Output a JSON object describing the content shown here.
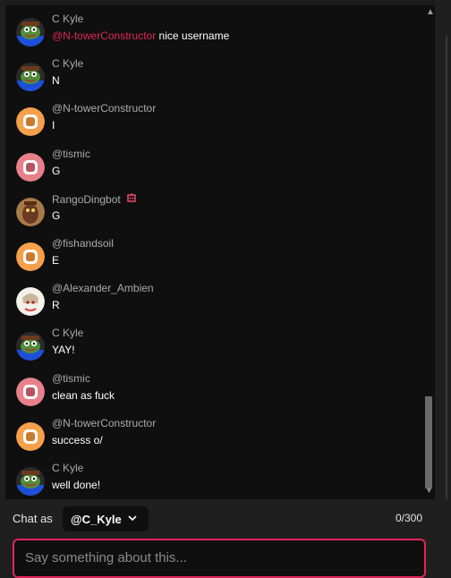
{
  "messages": [
    {
      "author": "C Kyle",
      "mention": "@N-towerConstructor",
      "text": " nice username",
      "avatar": "pepe-avatar-icon"
    },
    {
      "author": "C Kyle",
      "mention": "",
      "text": "N",
      "avatar": "pepe-avatar-icon"
    },
    {
      "author": "@N-towerConstructor",
      "mention": "",
      "text": "I",
      "avatar": "orange-default-avatar-icon"
    },
    {
      "author": "@tismic",
      "mention": "",
      "text": "G",
      "avatar": "red-default-avatar-icon"
    },
    {
      "author": "RangoDingbot",
      "mention": "",
      "text": "G",
      "avatar": "rango-avatar-icon",
      "badge": "bot-badge-icon"
    },
    {
      "author": "@fishandsoil",
      "mention": "",
      "text": "E",
      "avatar": "orange-default-avatar-icon"
    },
    {
      "author": "@Alexander_Ambien",
      "mention": "",
      "text": "R",
      "avatar": "anime-avatar-icon"
    },
    {
      "author": "C Kyle",
      "mention": "",
      "text": "YAY!",
      "avatar": "pepe-avatar-icon"
    },
    {
      "author": "@tismic",
      "mention": "",
      "text": "clean as fuck",
      "avatar": "red-default-avatar-icon"
    },
    {
      "author": "@N-towerConstructor",
      "mention": "",
      "text": "success o/",
      "avatar": "orange-default-avatar-icon"
    },
    {
      "author": "C Kyle",
      "mention": "",
      "text": "well done!",
      "avatar": "pepe-avatar-icon"
    }
  ],
  "footer": {
    "chat_as_label": "Chat as",
    "username": "@C_Kyle",
    "counter": "0/300",
    "input_placeholder": "Say something about this..."
  },
  "colors": {
    "mention": "#e0245e",
    "input_border": "#e0245e",
    "orange_avatar": "#f5a04b",
    "red_avatar": "#e8808a"
  }
}
